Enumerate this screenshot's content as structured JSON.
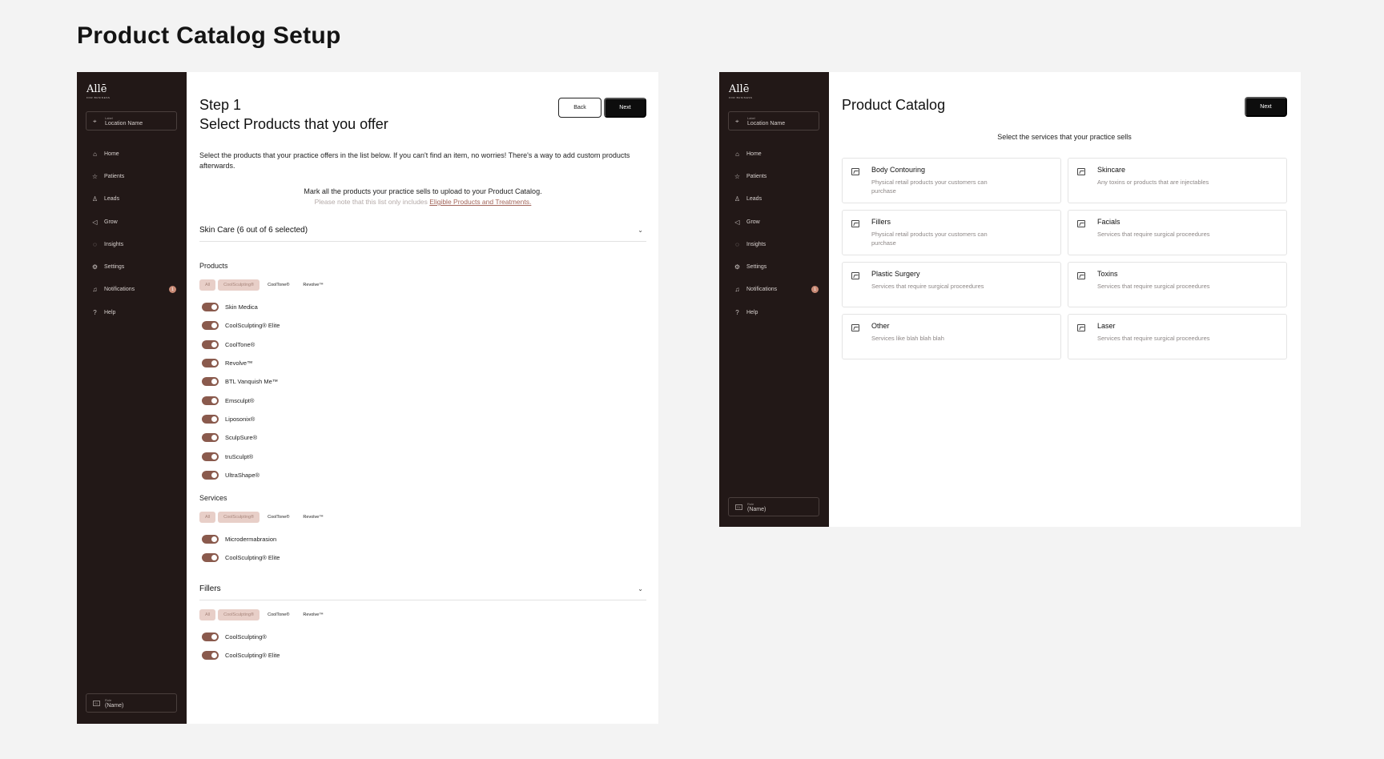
{
  "page_title": "Product Catalog Setup",
  "sidebar": {
    "logo": "Allē",
    "logo_sub": "FOR BUSINESS",
    "location_label": "Label",
    "location_value": "Location Name",
    "nav": [
      {
        "label": "Home",
        "icon": "home-icon",
        "glyph": "⌂"
      },
      {
        "label": "Patients",
        "icon": "star-icon",
        "glyph": "☆"
      },
      {
        "label": "Leads",
        "icon": "user-plus-icon",
        "glyph": "♙"
      },
      {
        "label": "Grow",
        "icon": "megaphone-icon",
        "glyph": "◁"
      },
      {
        "label": "Insights",
        "icon": "lightbulb-icon",
        "glyph": "◌"
      },
      {
        "label": "Settings",
        "icon": "gear-icon",
        "glyph": "⚙"
      },
      {
        "label": "Notifications",
        "icon": "bell-icon",
        "glyph": "♫",
        "badge": "1"
      },
      {
        "label": "Help",
        "icon": "help-icon",
        "glyph": "?"
      }
    ],
    "role_label": "Role",
    "role_value": "(Name)",
    "role_icon": "SL"
  },
  "step1": {
    "step_label": "Step 1",
    "title": "Select Products that you offer",
    "back_label": "Back",
    "next_label": "Next",
    "intro": "Select the products that your practice offers in the list below. If you can't find an item, no worries! There's a way to add custom products afterwards.",
    "mark_note": "Mark all the products your practice sells to upload to your Product Catalog.",
    "mark_sub_prefix": "Please note that this list only includes ",
    "mark_sub_link": "Eligible Products and Treatments.",
    "skin_care": {
      "title": "Skin Care (6 out of 6 selected)",
      "products_title": "Products",
      "chips": [
        "All",
        "CoolSculpting®",
        "CoolTone®",
        "Revolve™"
      ],
      "products": [
        "Skin Medica",
        "CoolSculpting® Elite",
        "CoolTone®",
        "Revolve™",
        "BTL Vanquish Me™",
        "Emsculpt®",
        "Liposonix®",
        "SculpSure®",
        "truSculpt®",
        "UltraShape®"
      ],
      "services_title": "Services",
      "services_chips": [
        "All",
        "CoolSculpting®",
        "CoolTone®",
        "Revolve™"
      ],
      "services": [
        "Microdermabrasion",
        "CoolSculpting® Elite"
      ]
    },
    "fillers": {
      "title": "Fillers",
      "chips": [
        "All",
        "CoolSculpting®",
        "CoolTone®",
        "Revolve™"
      ],
      "items": [
        "CoolSculpting®",
        "CoolSculpting® Elite"
      ]
    }
  },
  "catalog": {
    "title": "Product Catalog",
    "next_label": "Next",
    "subtitle": "Select the services that your practice sells",
    "cards": [
      {
        "title": "Body Contouring",
        "desc": "Physical retail products your customers can purchase"
      },
      {
        "title": "Skincare",
        "desc": "Any toxins or products that are injectables"
      },
      {
        "title": "Fillers",
        "desc": "Physical retail products your customers can purchase"
      },
      {
        "title": "Facials",
        "desc": "Services that require surgical proceedures"
      },
      {
        "title": "Plastic Surgery",
        "desc": "Services that require surgical proceedures"
      },
      {
        "title": "Toxins",
        "desc": "Services that require surgical proceedures"
      },
      {
        "title": "Other",
        "desc": "Services like blah blah blah"
      },
      {
        "title": "Laser",
        "desc": "Services that require surgical proceedures"
      }
    ]
  },
  "colors": {
    "sidebar_bg": "#221817",
    "toggle_on": "#8a5a4d",
    "chip_active": "#e8cfc8",
    "badge": "#c98a76",
    "link": "#a2655a"
  }
}
